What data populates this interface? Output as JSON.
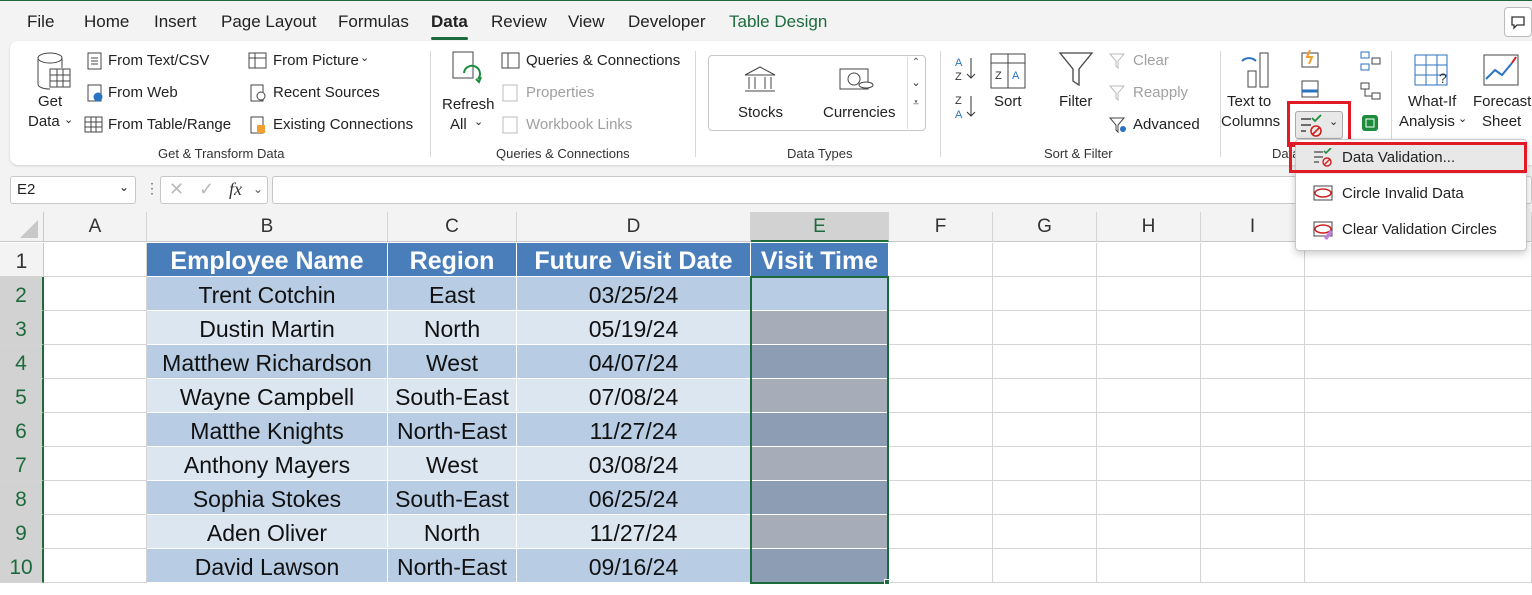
{
  "tabs": [
    {
      "label": "File"
    },
    {
      "label": "Home"
    },
    {
      "label": "Insert"
    },
    {
      "label": "Page Layout"
    },
    {
      "label": "Formulas"
    },
    {
      "label": "Data",
      "active": true
    },
    {
      "label": "Review"
    },
    {
      "label": "View"
    },
    {
      "label": "Developer"
    },
    {
      "label": "Table Design"
    }
  ],
  "ribbon": {
    "get_transform": {
      "get_data": "Get",
      "get_data2": "Data",
      "from_text_csv": "From Text/CSV",
      "from_web": "From Web",
      "from_table_range": "From Table/Range",
      "from_picture": "From Picture",
      "recent_sources": "Recent Sources",
      "existing_connections": "Existing Connections",
      "group_label": "Get & Transform Data"
    },
    "queries": {
      "refresh_all": "Refresh",
      "refresh_all2": "All",
      "queries_connections": "Queries & Connections",
      "properties": "Properties",
      "workbook_links": "Workbook Links",
      "group_label": "Queries & Connections"
    },
    "data_types": {
      "stocks": "Stocks",
      "currencies": "Currencies",
      "group_label": "Data Types"
    },
    "sort_filter": {
      "sort": "Sort",
      "filter": "Filter",
      "clear": "Clear",
      "reapply": "Reapply",
      "advanced": "Advanced",
      "group_label": "Sort & Filter"
    },
    "data_tools": {
      "text_to_columns": "Text to",
      "text_to_columns2": "Columns",
      "group_label": "Data Tools"
    },
    "forecast": {
      "what_if": "What-If",
      "what_if2": "Analysis",
      "forecast_sheet": "Forecast",
      "forecast_sheet2": "Sheet"
    }
  },
  "dropdown_menu": {
    "items": [
      {
        "label": "Data Validation...",
        "highlighted": true
      },
      {
        "label": "Circle Invalid Data"
      },
      {
        "label": "Clear Validation Circles"
      }
    ]
  },
  "formula_bar": {
    "name_box": "E2",
    "fx": "fx",
    "value": ""
  },
  "sheet": {
    "columns": [
      "A",
      "B",
      "C",
      "D",
      "E",
      "F",
      "G",
      "H",
      "I"
    ],
    "selected_column": "E",
    "rows": [
      "1",
      "2",
      "3",
      "4",
      "5",
      "6",
      "7",
      "8",
      "9",
      "10"
    ],
    "headers": [
      "Employee Name",
      "Region",
      "Future Visit Date",
      "Visit Time"
    ],
    "data": [
      [
        "Trent Cotchin",
        "East",
        "03/25/24",
        ""
      ],
      [
        "Dustin Martin",
        "North",
        "05/19/24",
        ""
      ],
      [
        "Matthew Richardson",
        "West",
        "04/07/24",
        ""
      ],
      [
        "Wayne Campbell",
        "South-East",
        "07/08/24",
        ""
      ],
      [
        "Matthe Knights",
        "North-East",
        "11/27/24",
        ""
      ],
      [
        "Anthony Mayers",
        "West",
        "03/08/24",
        ""
      ],
      [
        "Sophia Stokes",
        "South-East",
        "06/25/24",
        ""
      ],
      [
        "Aden Oliver",
        "North",
        "11/27/24",
        ""
      ],
      [
        "David Lawson",
        "North-East",
        "09/16/24",
        ""
      ]
    ]
  },
  "colors": {
    "accent": "#1d6b3c",
    "table_header": "#4a7ebb",
    "band_dark": "#b8cce4",
    "band_light": "#dce6f1",
    "highlight_box": "#e01b24"
  }
}
